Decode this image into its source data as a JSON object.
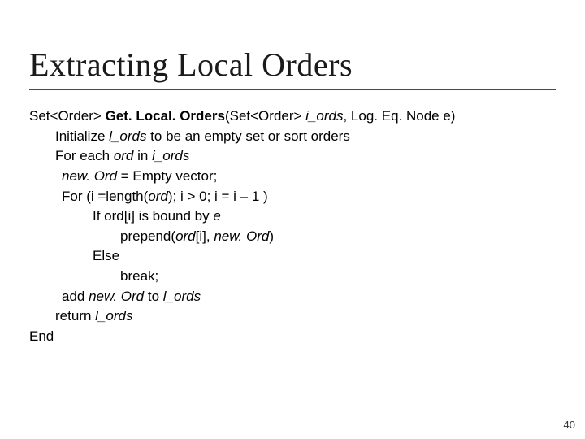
{
  "title": "Extracting Local Orders",
  "body": {
    "sig_pre": "Set<Order> ",
    "fname": "Get. Local. Orders",
    "sig_mid1": "(Set<Order> ",
    "sig_arg1": "i_ords",
    "sig_mid2": ", Log. Eq. Node e)",
    "l1a": "Initialize ",
    "l1b": "l_ords",
    "l1c": " to be an empty set or sort orders",
    "l2a": "For each ",
    "l2b": "ord",
    "l2c": " in ",
    "l2d": "i_ords",
    "l3a": "new. Ord",
    "l3b": " = Empty vector;",
    "l4a": "For (i =length(",
    "l4b": "ord",
    "l4c": ");  i > 0;  i = i – 1 )",
    "l5a": "If ord[i] is bound by ",
    "l5b": "e",
    "l6a": "prepend(",
    "l6b": "ord",
    "l6c": "[i], ",
    "l6d": "new. Ord",
    "l6e": ")",
    "l7": "Else",
    "l8": "break;",
    "l9a": "add ",
    "l9b": "new. Ord",
    "l9c": " to ",
    "l9d": "l_ords",
    "l10a": "return ",
    "l10b": "l_ords",
    "l11": "End"
  },
  "pagenum": "40"
}
